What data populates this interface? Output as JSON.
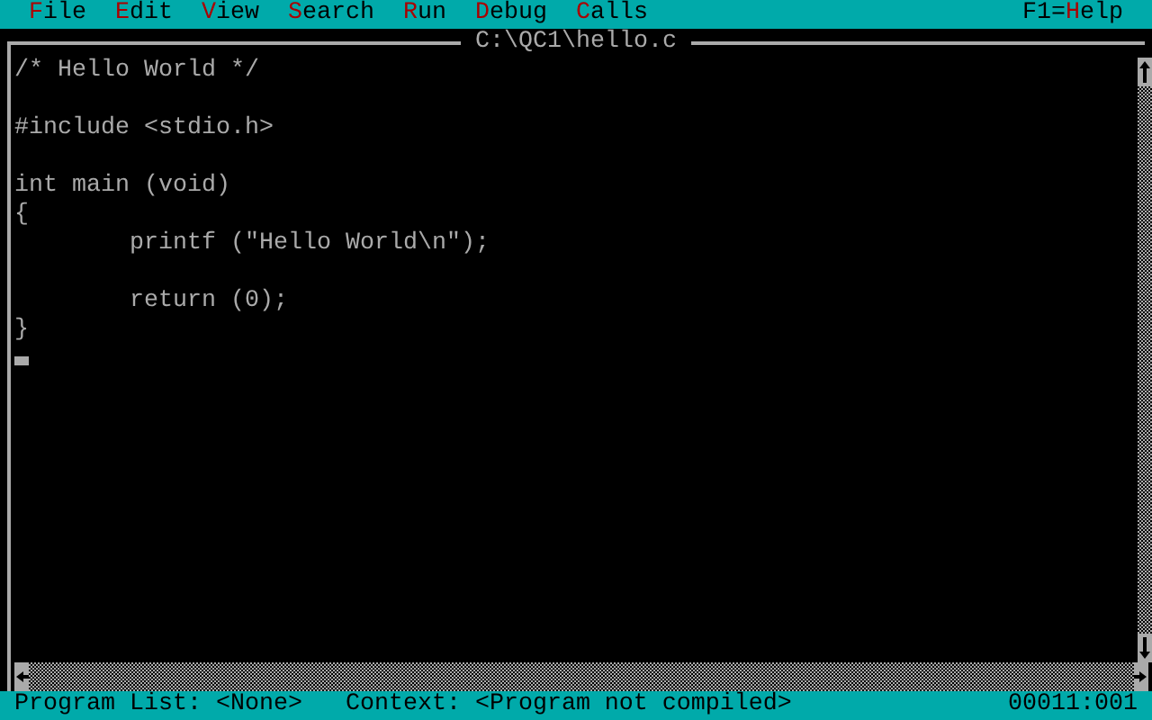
{
  "menu": [
    {
      "hot": "F",
      "after": "ile"
    },
    {
      "hot": "E",
      "after": "dit"
    },
    {
      "hot": "V",
      "after": "iew"
    },
    {
      "hot": "S",
      "after": "earch"
    },
    {
      "hot": "R",
      "after": "un"
    },
    {
      "hot": "D",
      "after": "ebug"
    },
    {
      "hot": "C",
      "after": "alls"
    }
  ],
  "help": {
    "before": "F1=",
    "hot": "H",
    "after": "elp"
  },
  "window": {
    "title": "C:\\QC1\\hello.c"
  },
  "code": "/* Hello World */\n\n#include <stdio.h>\n\nint main (void)\n{\n        printf (\"Hello World\\n\");\n\n        return (0);\n}",
  "status_bar": {
    "program_list": "Program List: <None>",
    "context": "Context: <Program not compiled>",
    "position": "00011:001"
  }
}
